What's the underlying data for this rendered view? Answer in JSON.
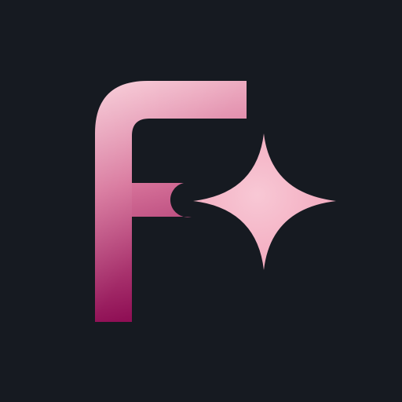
{
  "logo": {
    "letter_icon": "letter-f-icon",
    "sparkle_icon": "four-point-sparkle-icon"
  },
  "colors": {
    "background": "#161a21",
    "letter_top": "#f7c6d3",
    "letter_mid": "#d7739a",
    "letter_bottom": "#8f0f55",
    "sparkle": "#f2a8bd",
    "sparkle_highlight": "#f8c8d5"
  }
}
